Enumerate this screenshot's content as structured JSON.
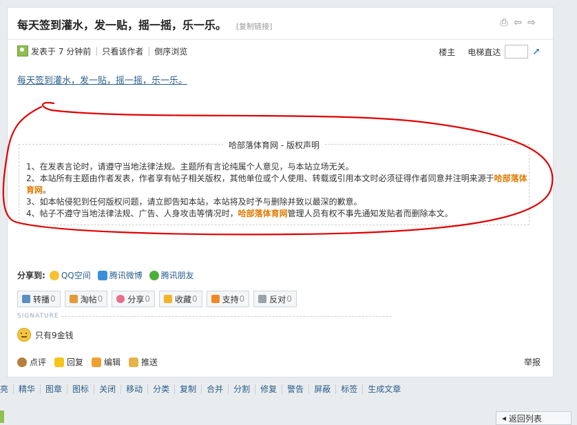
{
  "post": {
    "title": "每天签到灌水，发一贴，摇一摇，乐一乐。",
    "copy_link": "[复制链接]",
    "meta": {
      "posted": "发表于 7 分钟前",
      "only_author": "只看该作者",
      "reverse": "倒序浏览",
      "floor_owner": "楼主",
      "elevator": "电梯直达"
    },
    "content_link": "每天签到灌水，发一贴，摇一摇，乐一乐。",
    "copyright": {
      "title": "哈部落体育网 - 版权声明",
      "line1": "1、在发表言论时，请遵守当地法律法规。主题所有言论纯属个人意见，与本站立场无关。",
      "line2_a": "2、本站所有主题由作者发表，作者享有帖子相关版权，其他单位或个人使用、转载或引用本文时必须征得作者同意并注明来源于",
      "line2_hl": "哈部落体育网",
      "line2_b": "。",
      "line3": "3、如本帖侵犯到任何版权问题，请立即告知本站，本站将及时予与删除并致以最深的歉意。",
      "line4_a": "4、帖子不遵守当地法律法规、广告、人身攻击等情况时，",
      "line4_hl": "哈部落体育网",
      "line4_b": "管理人员有权不事先通知发贴者而删除本文。"
    },
    "share": {
      "label": "分享到:",
      "items": [
        "QQ空间",
        "腾讯微博",
        "腾讯朋友"
      ]
    },
    "actions": [
      {
        "label": "转播",
        "count": "0"
      },
      {
        "label": "淘帖",
        "count": "0"
      },
      {
        "label": "分享",
        "count": "0"
      },
      {
        "label": "收藏",
        "count": "0"
      },
      {
        "label": "支持",
        "count": "0"
      },
      {
        "label": "反对",
        "count": "0"
      }
    ],
    "signature_label": "SIGNATURE",
    "signature_text": "只有9金钱",
    "bottom_actions": [
      "点评",
      "回复",
      "编辑",
      "推送"
    ],
    "report": "举报"
  },
  "admin_bar": [
    "亮",
    "精华",
    "图章",
    "图标",
    "关闭",
    "移动",
    "分类",
    "复制",
    "合并",
    "分割",
    "修复",
    "警告",
    "屏蔽",
    "标签",
    "生成文章"
  ],
  "back_button": "返回列表",
  "colors": {
    "accent_link": "#2a5e8c",
    "highlight": "#e07b00",
    "annotation": "#e00000"
  }
}
